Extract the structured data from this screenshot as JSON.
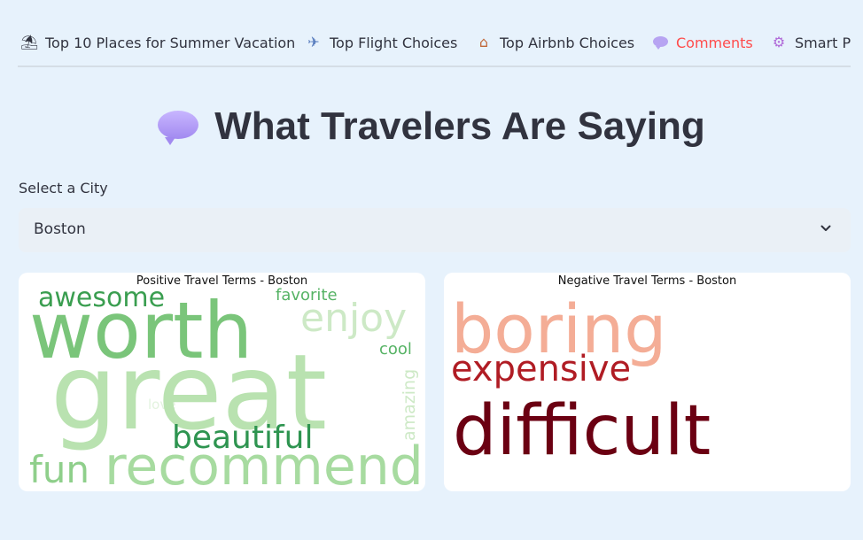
{
  "tabs": [
    {
      "label": "Top 10 Places for Summer Vacation",
      "icon": "beach-umbrella-icon"
    },
    {
      "label": "Top Flight Choices",
      "icon": "airplane-icon"
    },
    {
      "label": "Top Airbnb Choices",
      "icon": "house-icon"
    },
    {
      "label": "Comments",
      "icon": "speech-bubble-icon",
      "active": true
    },
    {
      "label": "Smart P",
      "icon": "robot-icon"
    }
  ],
  "heading": {
    "text": "What Travelers Are Saying",
    "icon": "speech-bubble-icon"
  },
  "select": {
    "label": "Select a City",
    "value": "Boston"
  },
  "positive": {
    "title": "Positive Travel Terms - Boston",
    "words": [
      "worth",
      "great",
      "recommend",
      "awesome",
      "enjoy",
      "favorite",
      "cool",
      "beautiful",
      "fun",
      "amazing",
      "love"
    ]
  },
  "negative": {
    "title": "Negative Travel Terms - Boston",
    "words": [
      "boring",
      "expensive",
      "difficult"
    ]
  },
  "colors": {
    "accent": "#ff4b4b",
    "background": "#e7f2fc"
  }
}
